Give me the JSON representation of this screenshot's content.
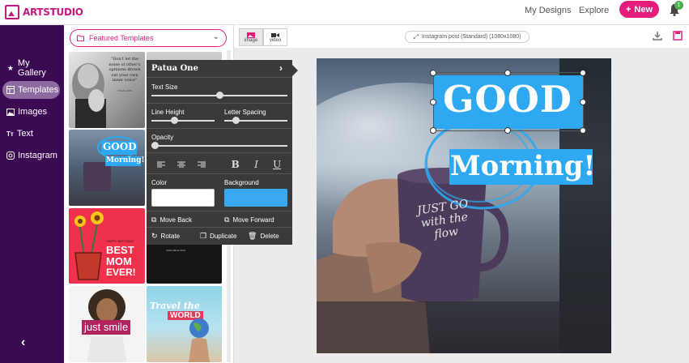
{
  "app": {
    "name_art": "ART",
    "name_studio": "STUDIO",
    "nav_my_designs": "My Designs",
    "nav_explore": "Explore",
    "new_button": "New",
    "notifications_count": "1"
  },
  "sidebar": {
    "items": [
      {
        "label": "My Gallery",
        "icon": "star-icon"
      },
      {
        "label": "Templates",
        "icon": "templates-icon",
        "active": true
      },
      {
        "label": "Images",
        "icon": "image-icon"
      },
      {
        "label": "Text",
        "icon": "text-icon",
        "icon_text": "Tт"
      },
      {
        "label": "Instagram",
        "icon": "instagram-icon"
      }
    ]
  },
  "templates": {
    "dropdown_label": "Featured Templates",
    "thumbs": {
      "quote": "\"Don't let the noise of other's opinions drown out your own inner voice\"",
      "quote_author": "STEVE JOBS",
      "good": "GOOD",
      "morning": "Morning!",
      "happy_birthday": "HAPPY BIRTHDAY",
      "best": "BEST",
      "mom": "MOM",
      "ever": "EVER!",
      "new_collection": "new collection",
      "available_now": "AVAILABLE NOW",
      "just_smile": "just smile",
      "travel_the": "Travel the",
      "world": "WORLD"
    }
  },
  "toolbar": {
    "image_label": "image",
    "video_label": "video",
    "size_label": "Instagram post (Standard) (1080x1080)"
  },
  "text_panel": {
    "font_name": "Patua One",
    "text_size_label": "Text Size",
    "line_height_label": "Line Height",
    "letter_spacing_label": "Letter Spacing",
    "opacity_label": "Opacity",
    "color_label": "Color",
    "background_label": "Background",
    "text_color": "#ffffff",
    "background_color": "#3aa8f2",
    "move_back": "Move Back",
    "move_forward": "Move Forward",
    "rotate": "Rotate",
    "duplicate": "Duplicate",
    "delete": "Delete",
    "text_size": 0.5,
    "line_height": 0.35,
    "letter_spacing": 0.15,
    "opacity": 0.0
  },
  "canvas": {
    "line1": "GOOD",
    "line2": "Morning!",
    "mug_text": "JUST GO with the flow"
  },
  "colors": {
    "brand": "#e41d7d",
    "sidebar": "#3b0a52",
    "text_box": "#2ea9f1"
  }
}
